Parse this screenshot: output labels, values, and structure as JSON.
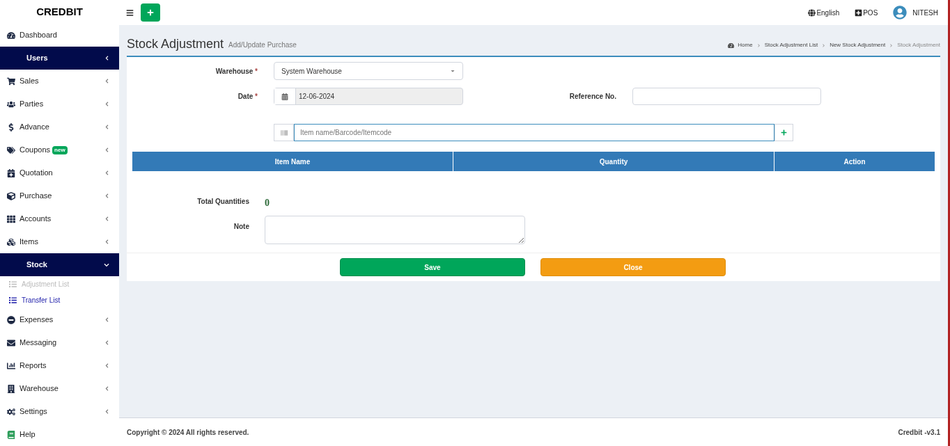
{
  "brand": "CREDBIT",
  "topbar": {
    "language": "English",
    "pos": "POS",
    "user": "NITESH"
  },
  "sidebar": {
    "items": [
      {
        "label": "Dashboard",
        "kind": "link",
        "selected": false
      },
      {
        "label": "Users",
        "kind": "menu",
        "selected": true,
        "expanded": false
      },
      {
        "label": "Sales",
        "kind": "menu",
        "selected": false,
        "expanded": false
      },
      {
        "label": "Parties",
        "kind": "menu",
        "selected": false,
        "expanded": false
      },
      {
        "label": "Advance",
        "kind": "menu",
        "selected": false,
        "expanded": false
      },
      {
        "label": "Coupons",
        "kind": "menu",
        "selected": false,
        "expanded": false,
        "badge": "new"
      },
      {
        "label": "Quotation",
        "kind": "menu",
        "selected": false,
        "expanded": false
      },
      {
        "label": "Purchase",
        "kind": "menu",
        "selected": false,
        "expanded": false
      },
      {
        "label": "Accounts",
        "kind": "menu",
        "selected": false,
        "expanded": false
      },
      {
        "label": "Items",
        "kind": "menu",
        "selected": false,
        "expanded": false
      },
      {
        "label": "Stock",
        "kind": "menu",
        "selected": true,
        "expanded": true,
        "children": [
          {
            "label": "Adjustment List",
            "selected": true
          },
          {
            "label": "Transfer List",
            "selected": false
          }
        ]
      },
      {
        "label": "Expenses",
        "kind": "menu",
        "selected": false,
        "expanded": false
      },
      {
        "label": "Messaging",
        "kind": "menu",
        "selected": false,
        "expanded": false
      },
      {
        "label": "Reports",
        "kind": "menu",
        "selected": false,
        "expanded": false
      },
      {
        "label": "Warehouse",
        "kind": "menu",
        "selected": false,
        "expanded": false
      },
      {
        "label": "Settings",
        "kind": "menu",
        "selected": false,
        "expanded": false
      },
      {
        "label": "Help",
        "kind": "link",
        "selected": false
      }
    ]
  },
  "page": {
    "title": "Stock Adjustment",
    "subtitle": "Add/Update Purchase",
    "breadcrumb": [
      "Home",
      "Stock Adjustment List",
      "New Stock Adjustment",
      "Stock Adjustment"
    ]
  },
  "form": {
    "warehouse": {
      "label": "Warehouse",
      "required": "*",
      "value": "System Warehouse"
    },
    "date": {
      "label": "Date",
      "required": "*",
      "value": "12-06-2024"
    },
    "reference": {
      "label": "Reference No."
    },
    "item_search": {
      "placeholder": "Item name/Barcode/Itemcode"
    },
    "table": {
      "columns": [
        "Item Name",
        "Quantity",
        "Action"
      ]
    },
    "total": {
      "label": "Total Quantities",
      "value": "0"
    },
    "note": {
      "label": "Note"
    },
    "buttons": [
      {
        "label": "Save",
        "kind": "save"
      },
      {
        "label": "Close",
        "kind": "close"
      }
    ]
  },
  "footer": {
    "copyright": "Copyright © 2024 All rights reserved.",
    "version": "Credbit -v3.1"
  }
}
